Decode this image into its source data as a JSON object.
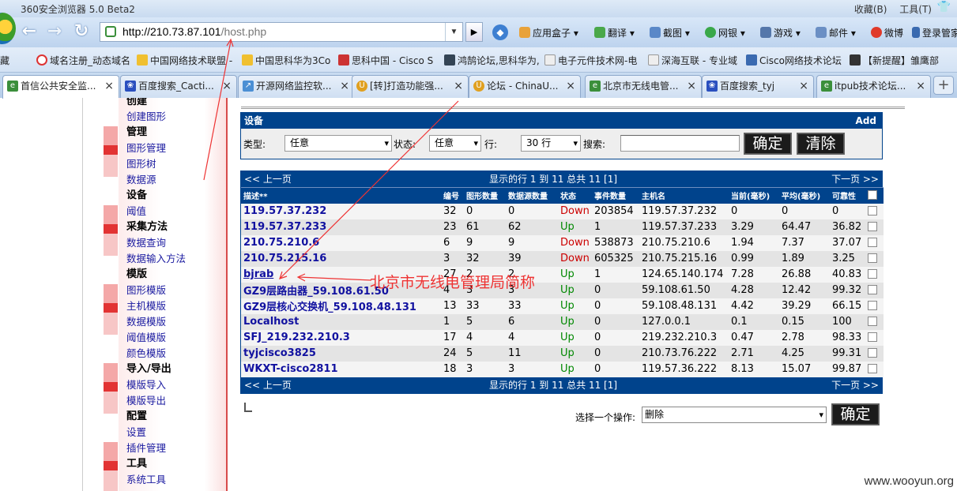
{
  "browser": {
    "title": "360安全浏览器 5.0 Beta2",
    "title_menu": [
      "收藏(B)",
      "工具(T)"
    ],
    "url_host": "http://210.73.87.101",
    "url_path": "/host.php",
    "toolbar": [
      "应用盒子",
      "翻译",
      "截图",
      "网银",
      "游戏",
      "邮件",
      "微博",
      "登录管家"
    ]
  },
  "bookmarks": [
    "藏",
    "域名注册_动态域名",
    "中国网络技术联盟 -",
    "中国思科华为3Co",
    "思科中国 - Cisco S",
    "鸿鹄论坛,思科华为,",
    "电子元件技术网-电",
    "深海互联 - 专业域",
    "Cisco网络技术论坛",
    "【新提醒】雏鹰部"
  ],
  "tabs": [
    "首信公共安全监...",
    "百度搜索_Cacti...",
    "开源网络监控软...",
    "[转]打造功能强...",
    "论坛 - ChinaU...",
    "北京市无线电管...",
    "百度搜索_tyj",
    "itpub技术论坛..."
  ],
  "sidebar": [
    "创建",
    "创建图形",
    "管理",
    "图形管理",
    "图形树",
    "数据源",
    "设备",
    "阈值",
    "采集方法",
    "数据查询",
    "数据输入方法",
    "模版",
    "图形模版",
    "主机模版",
    "数据模版",
    "阈值模版",
    "颜色模版",
    "导入/导出",
    "模版导入",
    "模版导出",
    "配置",
    "设置",
    "插件管理",
    "工具",
    "系统工具"
  ],
  "device_panel": {
    "title": "设备",
    "add": "Add",
    "type_label": "类型:",
    "type_value": "任意",
    "status_label": "状态:",
    "status_value": "任意",
    "rows_label": "行:",
    "rows_value": "30 行",
    "search_label": "搜索:",
    "search_value": "",
    "confirm": "确定",
    "clear": "清除"
  },
  "table": {
    "prev": "<< 上一页",
    "next": "下一页 >>",
    "summary": "显示的行 1 到 11 总共 11 [1]",
    "headers": [
      "描述**",
      "编号",
      "图形数量",
      "数据源数量",
      "状态",
      "事件数量",
      "主机名",
      "当前(毫秒)",
      "平均(毫秒)",
      "可靠性"
    ],
    "rows": [
      [
        "119.57.37.232",
        "32",
        "0",
        "0",
        "Down",
        "203854",
        "119.57.37.232",
        "0",
        "0",
        "0"
      ],
      [
        "119.57.37.233",
        "23",
        "61",
        "62",
        "Up",
        "1",
        "119.57.37.233",
        "3.29",
        "64.47",
        "36.82"
      ],
      [
        "210.75.210.6",
        "6",
        "9",
        "9",
        "Down",
        "538873",
        "210.75.210.6",
        "1.94",
        "7.37",
        "37.07"
      ],
      [
        "210.75.215.16",
        "3",
        "32",
        "39",
        "Down",
        "605325",
        "210.75.215.16",
        "0.99",
        "1.89",
        "3.25"
      ],
      [
        "bjrab",
        "27",
        "2",
        "2",
        "Up",
        "1",
        "124.65.140.174",
        "7.28",
        "26.88",
        "40.83"
      ],
      [
        "GZ9层路由器_59.108.61.50",
        "4",
        "3",
        "3",
        "Up",
        "0",
        "59.108.61.50",
        "4.28",
        "12.42",
        "99.32"
      ],
      [
        "GZ9层核心交换机_59.108.48.131",
        "13",
        "33",
        "33",
        "Up",
        "0",
        "59.108.48.131",
        "4.42",
        "39.29",
        "66.15"
      ],
      [
        "Localhost",
        "1",
        "5",
        "6",
        "Up",
        "0",
        "127.0.0.1",
        "0.1",
        "0.15",
        "100"
      ],
      [
        "SFJ_219.232.210.3",
        "17",
        "4",
        "4",
        "Up",
        "0",
        "219.232.210.3",
        "0.47",
        "2.78",
        "98.33"
      ],
      [
        "tyjcisco3825",
        "24",
        "5",
        "11",
        "Up",
        "0",
        "210.73.76.222",
        "2.71",
        "4.25",
        "99.31"
      ],
      [
        "WKXT-cisco2811",
        "18",
        "3",
        "3",
        "Up",
        "0",
        "119.57.36.222",
        "8.13",
        "15.07",
        "99.87"
      ]
    ]
  },
  "action": {
    "label": "选择一个操作:",
    "value": "删除",
    "confirm": "确定"
  },
  "annotation": "北京市无线电管理局简称",
  "watermark": "www.wooyun.org",
  "colors": {
    "header_blue": "#00438c",
    "down": "#cc0000",
    "up": "#008800",
    "annotation": "#ee3333"
  }
}
